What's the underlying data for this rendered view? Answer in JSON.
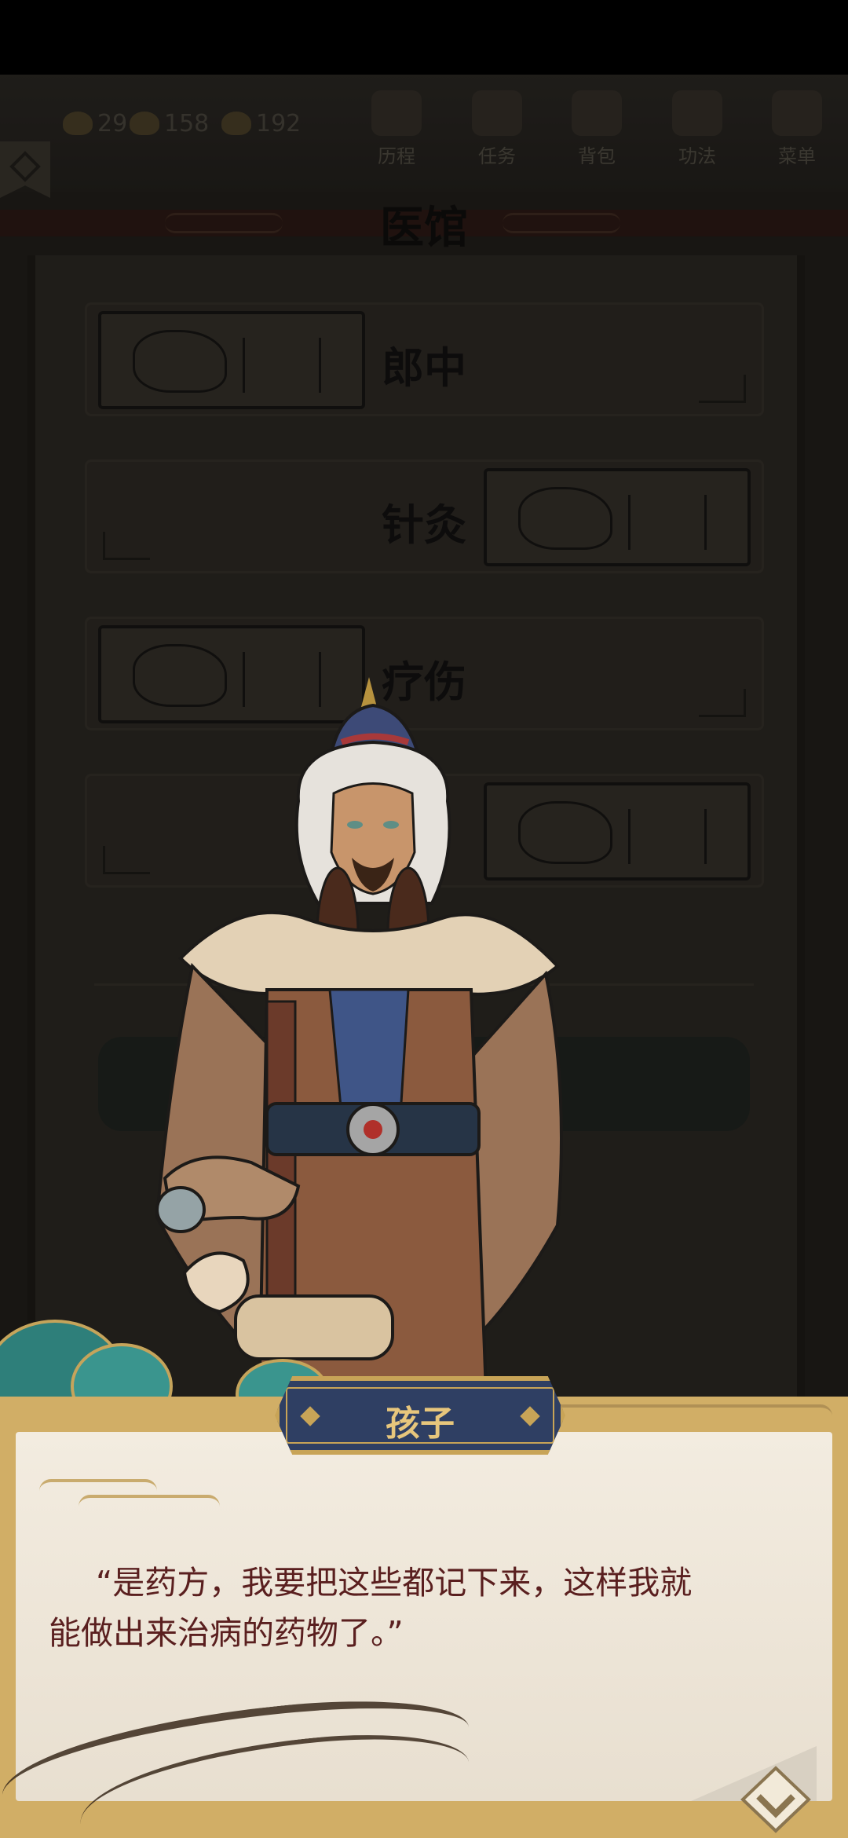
{
  "topbar": {
    "resources": [
      {
        "icon": "leaf-coin-icon",
        "value": "29"
      },
      {
        "icon": "leaf-icon",
        "value": "158"
      },
      {
        "icon": "grain-icon",
        "value": "192"
      }
    ],
    "menu": [
      {
        "label": "历程",
        "icon": "history-icon"
      },
      {
        "label": "任务",
        "icon": "task-icon"
      },
      {
        "label": "背包",
        "icon": "bag-icon"
      },
      {
        "label": "功法",
        "icon": "skill-book-icon"
      },
      {
        "label": "菜单",
        "icon": "fan-menu-icon"
      }
    ]
  },
  "hall": {
    "title": "医馆",
    "services": [
      {
        "label": "郎中"
      },
      {
        "label": "针灸"
      },
      {
        "label": "疗伤"
      }
    ]
  },
  "dialog": {
    "speaker": "孩子",
    "line1": "“是药方，我要把这些都记下来，这样我就",
    "line2": "能做出来治病的药物了。”"
  },
  "colors": {
    "dialog_frame": "#d1ae66",
    "dialog_text": "#5a1f1f",
    "nameplate_bg": "#2f3f63",
    "nameplate_text": "#e7c67c",
    "scene_dim": "#2a2620"
  }
}
